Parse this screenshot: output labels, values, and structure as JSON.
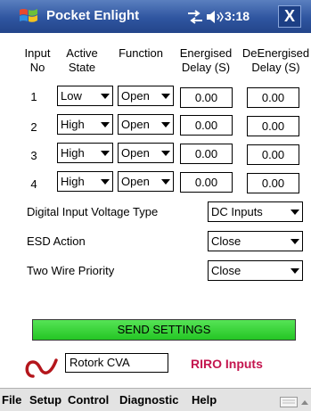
{
  "title_bar": {
    "app_title": "Pocket Enlight",
    "time": "3:18",
    "close_label": "X"
  },
  "grid": {
    "headers": {
      "input_line1": "Input",
      "input_line2": "No",
      "active_line1": "Active",
      "active_line2": "State",
      "function": "Function",
      "energised_line1": "Energised",
      "energised_line2": "Delay (S)",
      "deenergised_line1": "DeEnergised",
      "deenergised_line2": "Delay (S)"
    },
    "rows": [
      {
        "no": "1",
        "state": "Low",
        "function": "Open",
        "energised": "0.00",
        "deenergised": "0.00"
      },
      {
        "no": "2",
        "state": "High",
        "function": "Open",
        "energised": "0.00",
        "deenergised": "0.00"
      },
      {
        "no": "3",
        "state": "High",
        "function": "Open",
        "energised": "0.00",
        "deenergised": "0.00"
      },
      {
        "no": "4",
        "state": "High",
        "function": "Open",
        "energised": "0.00",
        "deenergised": "0.00"
      }
    ]
  },
  "settings": {
    "voltage_label": "Digital Input Voltage Type",
    "voltage_value": "DC Inputs",
    "esd_label": "ESD Action",
    "esd_value": "Close",
    "twowire_label": "Two Wire Priority",
    "twowire_value": "Close"
  },
  "send_button": "SEND SETTINGS",
  "footer": {
    "device": "Rotork CVA",
    "page_label": "RIRO Inputs"
  },
  "menu": [
    "File",
    "Setup",
    "Control",
    "Diagnostic",
    "Help"
  ],
  "colors": {
    "title_bar": "#2f55a0",
    "send_button": "#2fcc2f",
    "page_label": "#c4164f",
    "logo": "#b4161c"
  },
  "icons": [
    "windows-start-icon",
    "connectivity-icon",
    "volume-icon",
    "rotork-logo-icon",
    "keyboard-icon"
  ]
}
